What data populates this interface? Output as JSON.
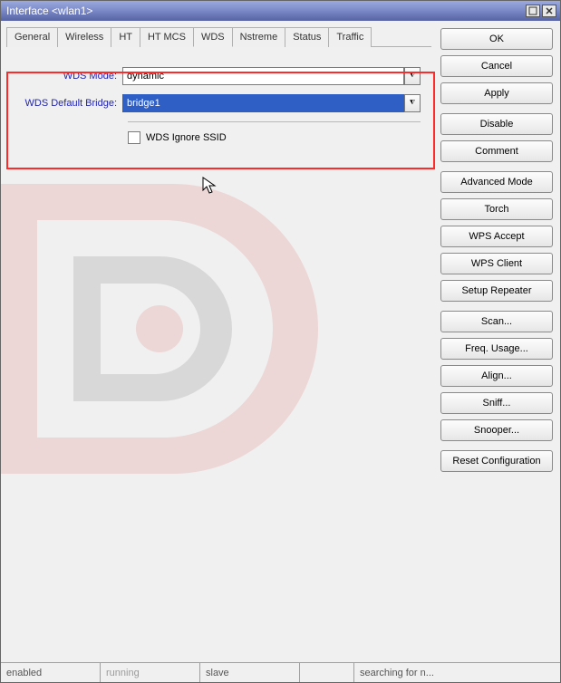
{
  "window": {
    "title": "Interface <wlan1>"
  },
  "tabs": [
    {
      "label": "General"
    },
    {
      "label": "Wireless"
    },
    {
      "label": "HT"
    },
    {
      "label": "HT MCS"
    },
    {
      "label": "WDS"
    },
    {
      "label": "Nstreme"
    },
    {
      "label": "Status"
    },
    {
      "label": "Traffic"
    }
  ],
  "active_tab": "WDS",
  "form": {
    "wds_mode": {
      "label": "WDS Mode:",
      "value": "dynamic"
    },
    "wds_bridge": {
      "label": "WDS Default Bridge:",
      "value": "bridge1"
    },
    "wds_ignore": {
      "label": "WDS Ignore SSID",
      "checked": false
    }
  },
  "buttons": {
    "ok": "OK",
    "cancel": "Cancel",
    "apply": "Apply",
    "disable": "Disable",
    "comment": "Comment",
    "advanced": "Advanced Mode",
    "torch": "Torch",
    "wps_accept": "WPS Accept",
    "wps_client": "WPS Client",
    "setup_repeater": "Setup Repeater",
    "scan": "Scan...",
    "freq_usage": "Freq. Usage...",
    "align": "Align...",
    "sniff": "Sniff...",
    "snooper": "Snooper...",
    "reset_config": "Reset Configuration"
  },
  "status": {
    "s1": "enabled",
    "s2": "running",
    "s3": "slave",
    "s4": "",
    "s5": "searching for n..."
  }
}
